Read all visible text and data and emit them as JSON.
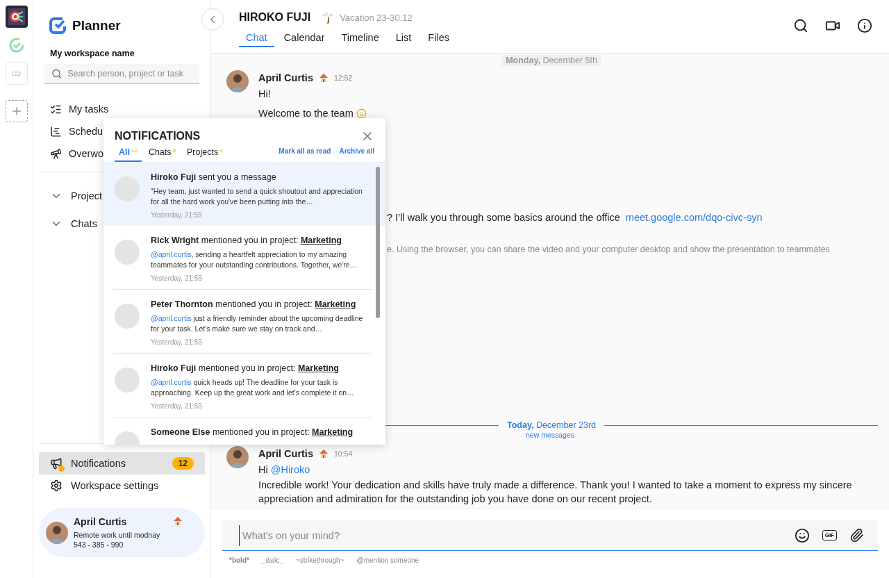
{
  "rail": {
    "items": [
      {
        "kind": "app"
      },
      {
        "kind": "check"
      },
      {
        "kind": "initials",
        "label": "CD"
      },
      {
        "kind": "add"
      }
    ]
  },
  "sidebar": {
    "brand": "Planner",
    "workspace": "My workspace name",
    "search": {
      "placeholder": "Search person, project or task"
    },
    "nav": [
      {
        "kind": "tasks",
        "label": "My tasks"
      },
      {
        "kind": "schedule",
        "label": "Schedu"
      },
      {
        "kind": "overwork",
        "label": "Overwo"
      }
    ],
    "groups": [
      {
        "label": "Project"
      },
      {
        "label": "Chats"
      }
    ],
    "bottom": [
      {
        "kind": "notifications",
        "label": "Notifications",
        "badge": "12",
        "selected": true
      },
      {
        "kind": "settings",
        "label": "Workspace settings",
        "selected": false
      }
    ],
    "user": {
      "name": "April Curtis",
      "status": "Remote work until modnay",
      "phone": "543 - 385 - 990"
    }
  },
  "header": {
    "name": "HIROKO FUJI",
    "status": "Vacation 23-30.12",
    "tabs": [
      {
        "label": "Chat",
        "selected": true
      },
      {
        "label": "Calendar",
        "selected": false
      },
      {
        "label": "Timeline",
        "selected": false
      },
      {
        "label": "List",
        "selected": false
      },
      {
        "label": "Files",
        "selected": false
      }
    ]
  },
  "chat": {
    "groups": [
      {
        "divider": "**Monday,** December 5th",
        "today": false,
        "messages": [
          {
            "author": "April Curtis",
            "time": "12:52",
            "lines": [
              {
                "kind": "plain",
                "text": "Hi!"
              },
              {
                "kind": "smile",
                "text": "Welcome to the team"
              },
              {
                "kind": "partial",
                "text": "? I’ll walk you through some basics around the office",
                "link": "meet.google.com/dqo-civc-syn"
              },
              {
                "kind": "muted",
                "text": "e. Using the browser, you can share the video and your computer desktop and show the presentation to teammates"
              }
            ]
          }
        ]
      },
      {
        "divider": "**Today,** December 23rd",
        "today": true,
        "note": "new messages",
        "messages": [
          {
            "author": "April Curtis",
            "time": "10:54",
            "lines": [
              {
                "kind": "greeting",
                "text": "Hi",
                "mention": "@Hiroko"
              },
              {
                "kind": "plain",
                "text": "Incredible work! Your dedication and skills have truly made a difference. Thank you! I wanted to take a moment to express my sincere appreciation and admiration for the outstanding job you have done on our recent project."
              }
            ]
          }
        ]
      }
    ]
  },
  "composer": {
    "placeholder": "What’s on your mind?",
    "gif": "GIF",
    "hints": [
      {
        "kind": "bold",
        "text": "*bold*"
      },
      {
        "kind": "italic",
        "text": "_italic_"
      },
      {
        "kind": "plain",
        "text": "~strikethrough~"
      },
      {
        "kind": "plain",
        "text": "@mention someone"
      }
    ]
  },
  "notifications": {
    "title": "NOTIFICATIONS",
    "tabs": [
      {
        "label": "All",
        "count": "12",
        "selected": true
      },
      {
        "label": "Chats",
        "count": "8",
        "selected": false
      },
      {
        "label": "Projects",
        "count": "4",
        "selected": false
      }
    ],
    "actions": [
      "Mark all as read",
      "Archive all"
    ],
    "items": [
      {
        "actor": "Hiroko Fuji",
        "action": "sent you a message",
        "text": "\"Hey team, just wanted to send a quick shoutout and appreciation for all the hard work you've been putting into the…",
        "time": "Yesterday, 21:55",
        "unread": true
      },
      {
        "actor": "Rick Wright",
        "action": "mentioned you in project:",
        "project": "Marketing",
        "mention": "@april.curtis",
        "text": ", sending a heartfelt appreciation to my amazing teammates for your outstanding contributions. Together, we're…",
        "time": "Yesterday, 21:55",
        "unread": false
      },
      {
        "actor": "Peter Thornton",
        "action": "mentioned you in project:",
        "project": "Marketing",
        "mention": "@april.curtis",
        "text": " just a friendly reminder about the upcoming deadline for your task. Let's make sure we stay on track and…",
        "time": "Yesterday, 21:55",
        "unread": false
      },
      {
        "actor": "Hiroko Fuji",
        "action": "mentioned you in project:",
        "project": "Marketing",
        "mention": "@april.curtis",
        "text": " quick heads up! The deadline for your task is approaching. Keep up the great work and let's complete it on…",
        "time": "Yesterday, 21:55",
        "unread": false
      },
      {
        "actor": "Someone Else",
        "action": "mentioned you in project:",
        "project": "Marketing",
        "unread": false
      }
    ]
  }
}
